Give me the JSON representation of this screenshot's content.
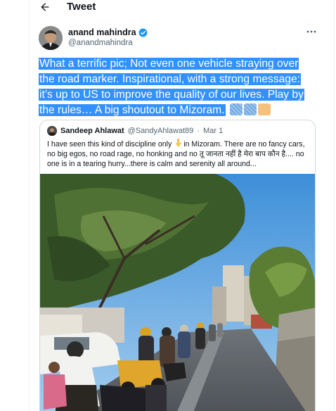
{
  "header": {
    "title": "Tweet"
  },
  "author": {
    "name": "anand mahindra",
    "handle": "@anandmahindra"
  },
  "tweet": {
    "lines": [
      "What a terrific pic; Not even one vehicle straying over",
      "the road marker. Inspirational, with a strong message:",
      "it’s up to US to improve the quality of our lives. Play by",
      "the rules… A big shoutout to Mizoram."
    ]
  },
  "quoted": {
    "name": "Sandeep Ahlawat",
    "handle": "@SandyAhlawat89",
    "separator": "·",
    "date": "Mar 1",
    "text_before_emoji": "I have seen this kind of discipline only ",
    "text_after_emoji": "in Mizoram. There are no fancy cars, no big egos, no road rage, no honking and no तू जानता नहीं है मेरा बाप कौन है.... no one is in a tearing hurry...there is calm and serenity all around..."
  },
  "colors": {
    "highlight": "#3391ff",
    "verified": "#1d9bf0",
    "border": "#cfd9de",
    "muted": "#536471"
  }
}
